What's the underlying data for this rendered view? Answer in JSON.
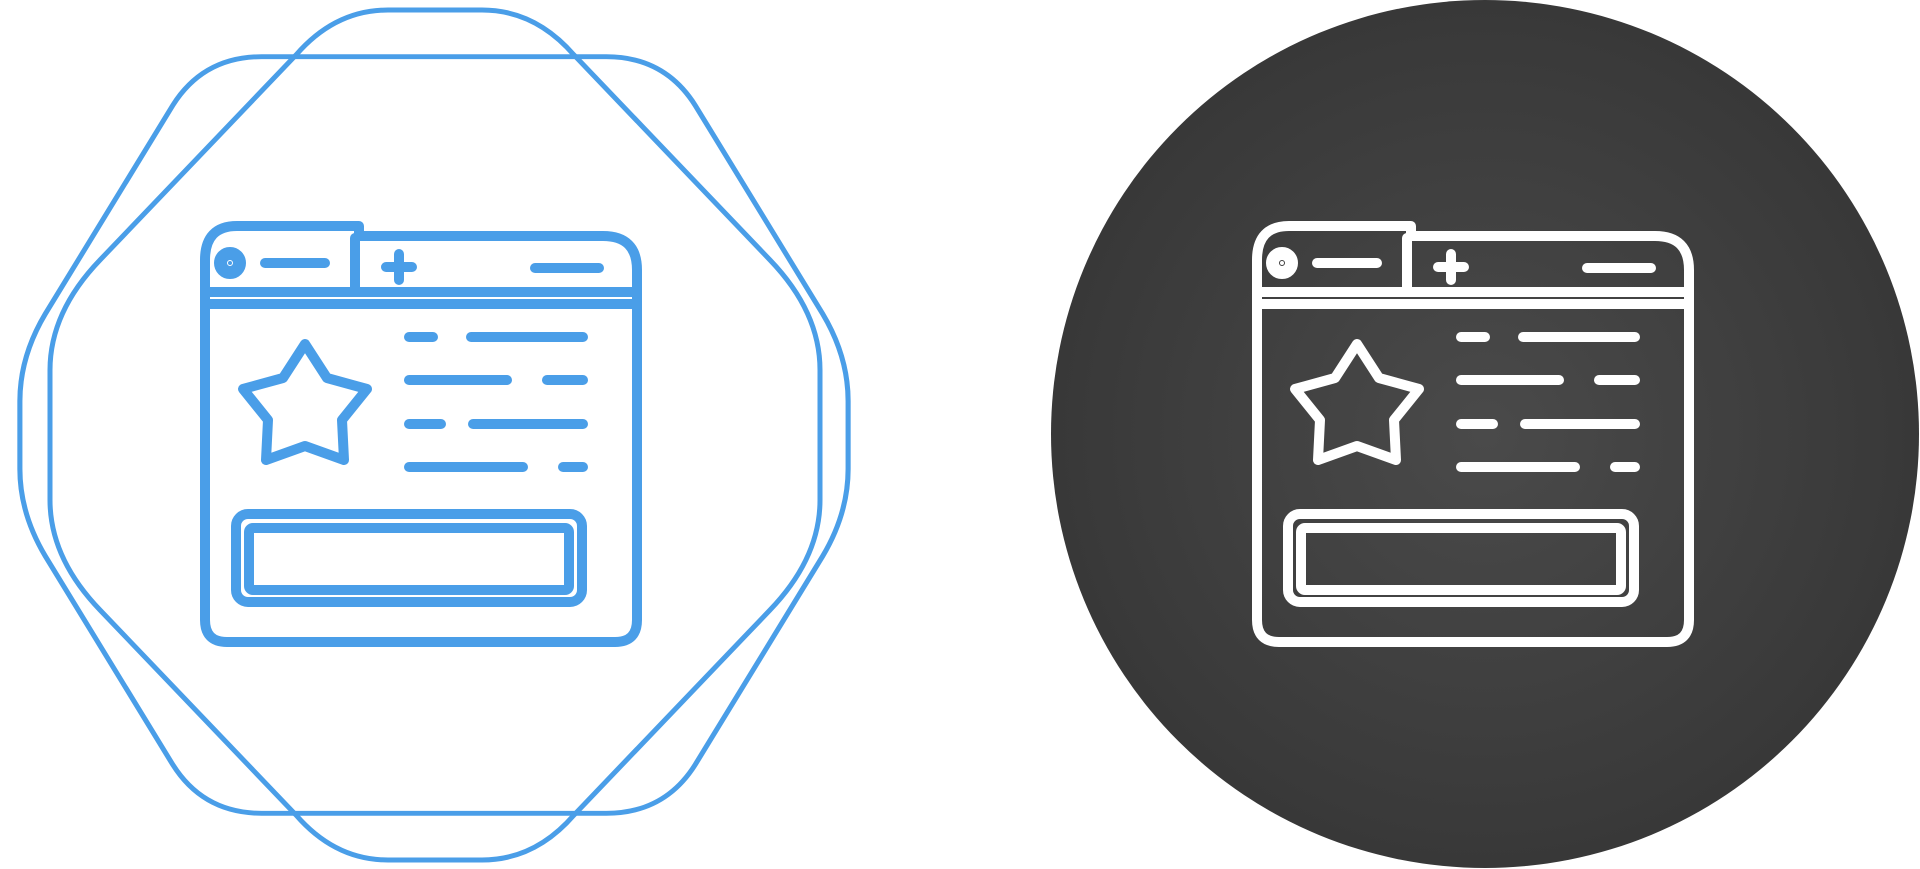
{
  "icons": [
    {
      "name": "favorite-webpage-icon",
      "variant": "line-blue-on-octagram-badge",
      "stroke_color": "#4a9ee8",
      "background_color": "#ffffff"
    },
    {
      "name": "favorite-webpage-icon",
      "variant": "line-white-on-dark-circle",
      "stroke_color": "#ffffff",
      "background_color": "#3f3f3f"
    }
  ]
}
